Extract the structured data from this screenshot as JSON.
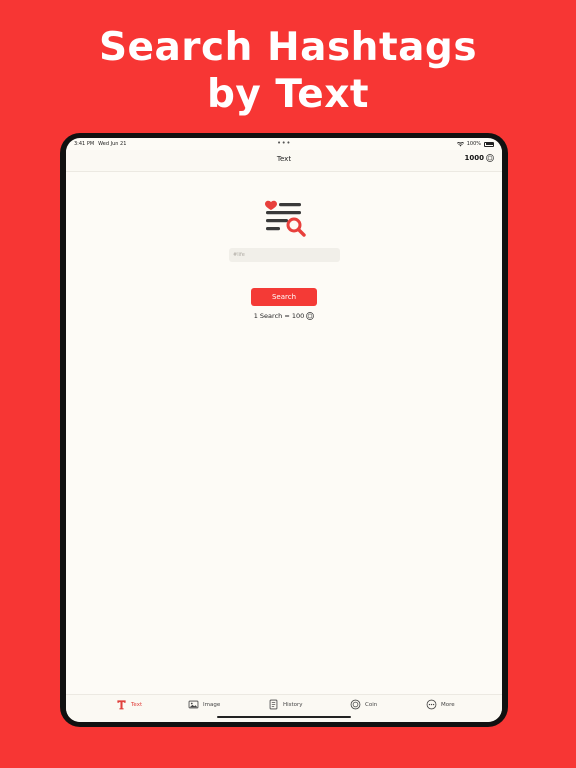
{
  "promo": {
    "headline_line1": "Search Hashtags",
    "headline_line2": "by Text"
  },
  "status_bar": {
    "time": "3:41 PM",
    "date": "Wed Jun 21",
    "battery": "100%"
  },
  "nav": {
    "title": "Text",
    "coin_balance": "1000"
  },
  "form": {
    "input_placeholder": "#life",
    "search_label": "Search",
    "cost_note": "1 Search = 100"
  },
  "tabs": [
    {
      "label": "Text",
      "icon": "text-icon",
      "active": true
    },
    {
      "label": "Image",
      "icon": "image-icon",
      "active": false
    },
    {
      "label": "History",
      "icon": "history-icon",
      "active": false
    },
    {
      "label": "Coin",
      "icon": "coin-icon",
      "active": false
    },
    {
      "label": "More",
      "icon": "more-icon",
      "active": false
    }
  ],
  "colors": {
    "background": "#f73634",
    "accent": "#f43a36",
    "screen": "#fdfbf6"
  }
}
